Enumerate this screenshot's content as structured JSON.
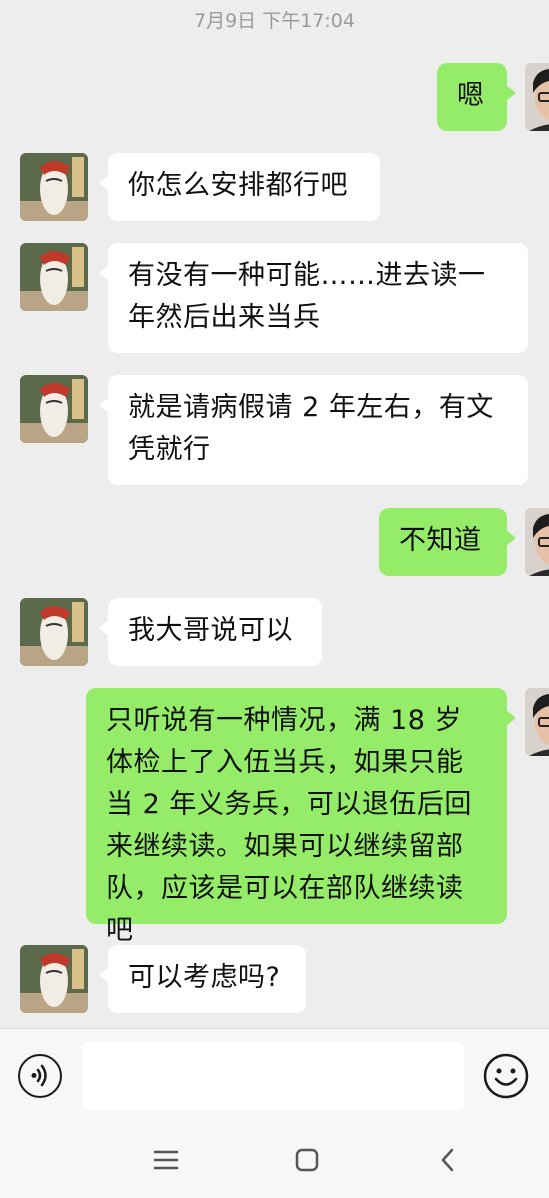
{
  "timestamp": "7月9日 下午17:04",
  "messages": [
    {
      "side": "right",
      "text": "嗯"
    },
    {
      "side": "left",
      "text": "你怎么安排都行吧"
    },
    {
      "side": "left",
      "text": "有没有一种可能……进去读一年然后出来当兵"
    },
    {
      "side": "left",
      "text": "就是请病假请 2 年左右，有文凭就行"
    },
    {
      "side": "right",
      "text": "不知道"
    },
    {
      "side": "left",
      "text": "我大哥说可以"
    },
    {
      "side": "right",
      "text": "只听说有一种情况，满 18 岁体检上了入伍当兵，如果只能当 2 年义务兵，可以退伍后回来继续读。如果可以继续留部队，应该是可以在部队继续读吧"
    },
    {
      "side": "left",
      "text": "可以考虑吗?"
    }
  ],
  "input_bar": {
    "voice_icon": "voice-icon",
    "emoji_icon": "emoji-icon",
    "placeholder": ""
  },
  "nav_bar": {
    "menu_icon": "menu-icon",
    "home_icon": "home-icon",
    "back_icon": "back-icon"
  },
  "colors": {
    "background": "#ededed",
    "bubble_self": "#95ec69",
    "bubble_other": "#ffffff",
    "timestamp": "#9a9a9a"
  }
}
